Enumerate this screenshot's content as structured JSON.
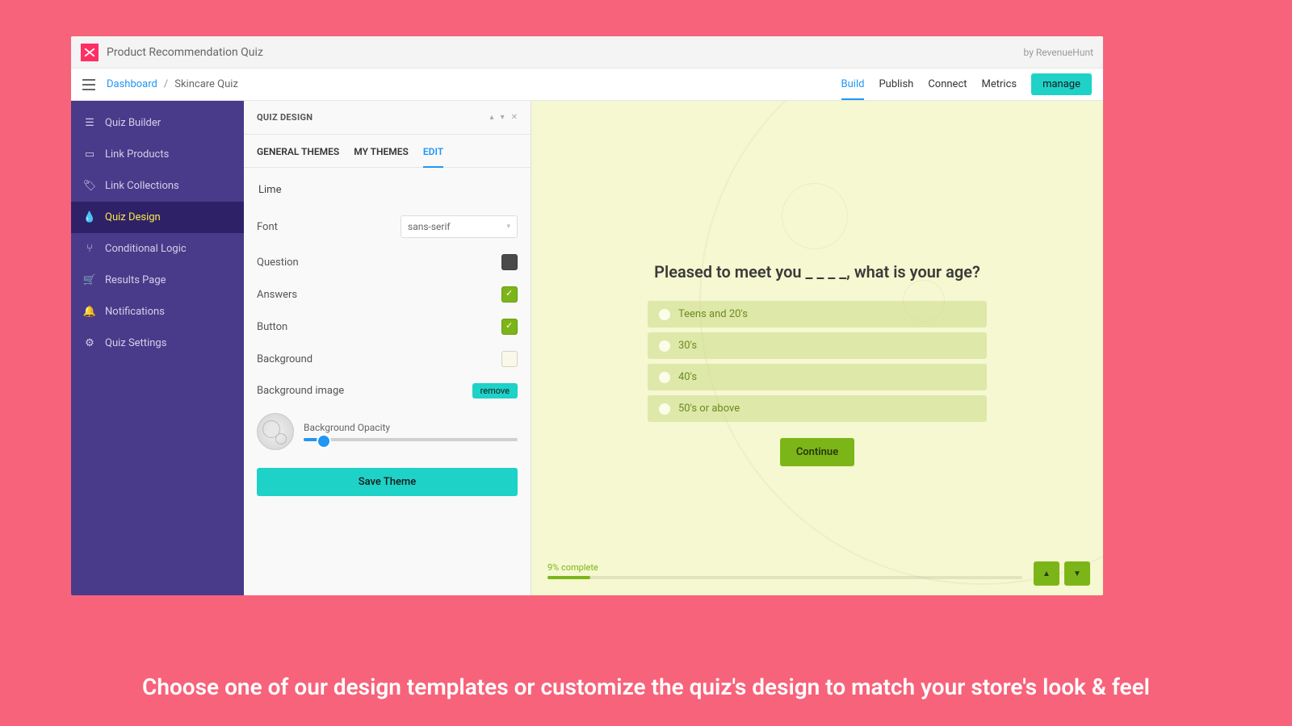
{
  "header": {
    "app_title": "Product Recommendation Quiz",
    "byline": "by RevenueHunt"
  },
  "breadcrumb": {
    "root": "Dashboard",
    "current": "Skincare Quiz"
  },
  "top_tabs": {
    "build": "Build",
    "publish": "Publish",
    "connect": "Connect",
    "metrics": "Metrics",
    "manage": "manage"
  },
  "sidebar": {
    "items": [
      {
        "label": "Quiz Builder"
      },
      {
        "label": "Link Products"
      },
      {
        "label": "Link Collections"
      },
      {
        "label": "Quiz Design"
      },
      {
        "label": "Conditional Logic"
      },
      {
        "label": "Results Page"
      },
      {
        "label": "Notifications"
      },
      {
        "label": "Quiz Settings"
      }
    ]
  },
  "panel": {
    "title": "QUIZ DESIGN",
    "tabs": {
      "general": "GENERAL THEMES",
      "my": "MY THEMES",
      "edit": "EDIT"
    },
    "theme_name": "Lime",
    "font_label": "Font",
    "font_value": "sans-serif",
    "question_label": "Question",
    "answers_label": "Answers",
    "button_label": "Button",
    "background_label": "Background",
    "bgimage_label": "Background image",
    "remove": "remove",
    "opacity_label": "Background Opacity",
    "save": "Save Theme",
    "colors": {
      "question": "#4a4a4a",
      "answers": "#7cb518",
      "button": "#7cb518",
      "background": "#faf8e8"
    }
  },
  "preview": {
    "question": "Pleased to meet you _ _ _ _, what is your age?",
    "answers": [
      "Teens and 20's",
      "30's",
      "40's",
      "50's or above"
    ],
    "continue": "Continue",
    "progress_text": "9% complete",
    "progress_percent": 9
  },
  "caption": "Choose one of our design templates or customize the quiz's design to match your store's look & feel"
}
